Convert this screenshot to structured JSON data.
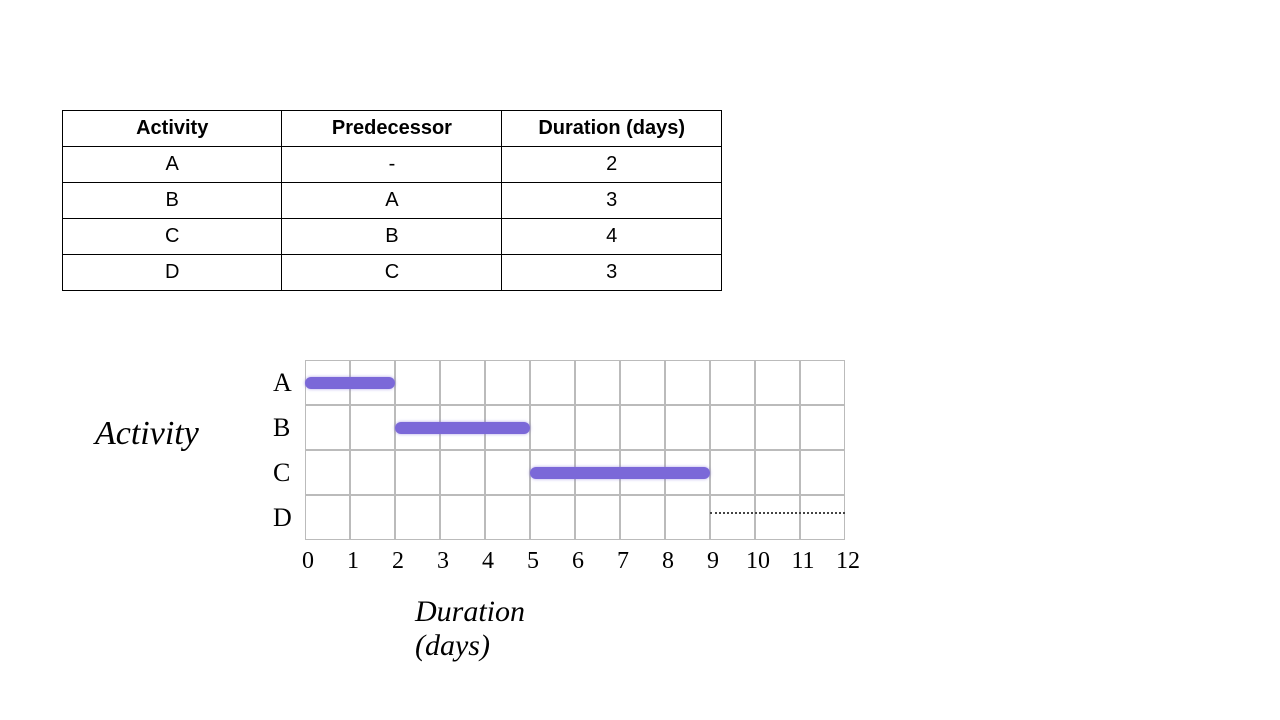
{
  "table": {
    "headers": {
      "activity": "Activity",
      "predecessor": "Predecessor",
      "duration": "Duration (days)"
    },
    "rows": [
      {
        "activity": "A",
        "predecessor": "-",
        "duration": "2"
      },
      {
        "activity": "B",
        "predecessor": "A",
        "duration": "3"
      },
      {
        "activity": "C",
        "predecessor": "B",
        "duration": "4"
      },
      {
        "activity": "D",
        "predecessor": "C",
        "duration": "3"
      }
    ]
  },
  "chart_data": {
    "type": "bar",
    "title": "",
    "ylabel": "Activity",
    "xlabel": "Duration (days)",
    "xlim": [
      0,
      12
    ],
    "x_ticks": [
      "0",
      "1",
      "2",
      "3",
      "4",
      "5",
      "6",
      "7",
      "8",
      "9",
      "10",
      "11",
      "12"
    ],
    "categories": [
      "A",
      "B",
      "C",
      "D"
    ],
    "series": [
      {
        "name": "A",
        "start": 0,
        "end": 2,
        "style": "solid"
      },
      {
        "name": "B",
        "start": 2,
        "end": 5,
        "style": "solid"
      },
      {
        "name": "C",
        "start": 5,
        "end": 9,
        "style": "solid"
      },
      {
        "name": "D",
        "start": 9,
        "end": 12,
        "style": "dashed"
      }
    ],
    "bar_color": "#7b68d8"
  }
}
